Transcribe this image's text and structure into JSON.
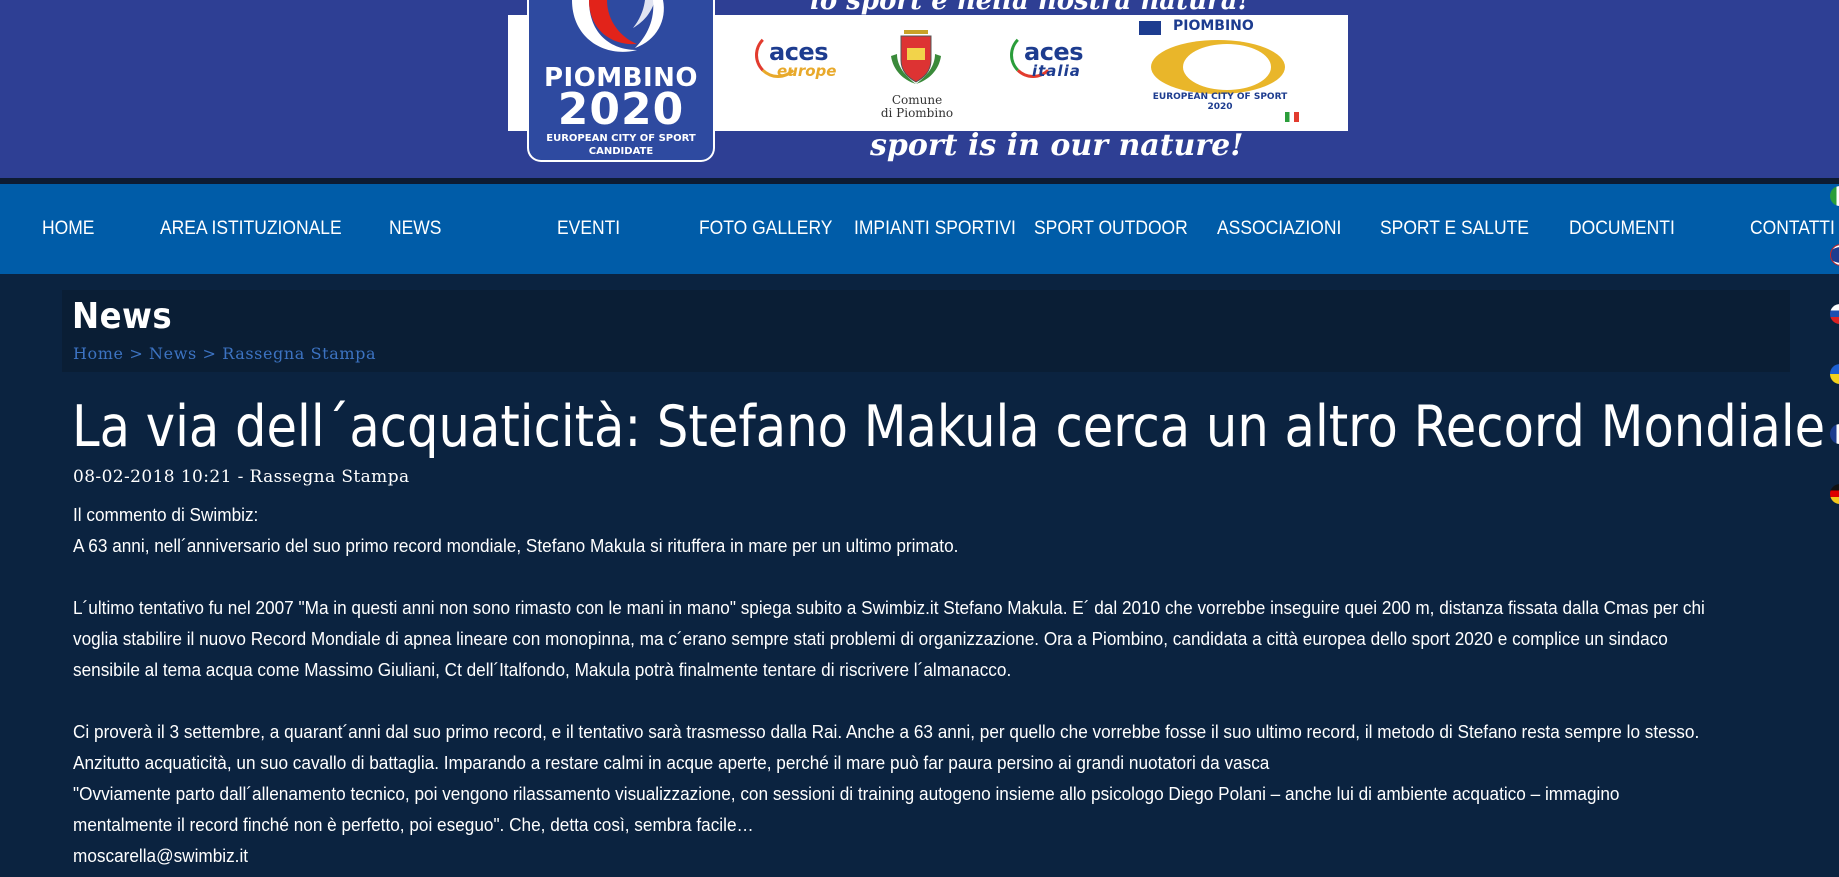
{
  "banner": {
    "top_text": "lo sport è nella nostra natura!",
    "logo_city": "PIOMBINO",
    "logo_year": "2020",
    "logo_sub_line1": "EUROPEAN CITY OF SPORT",
    "logo_sub_line2": "CANDIDATE",
    "aces_europe_word": "aces",
    "aces_europe_sub": "europe",
    "comune_line1": "Comune",
    "comune_line2": "di Piombino",
    "aces_italia_word": "aces",
    "aces_italia_sub": "italia",
    "ecs_title": "PIOMBINO",
    "ecs_sub_line1": "EUROPEAN CITY OF SPORT",
    "ecs_sub_line2": "2020",
    "slogan": "sport is in our nature!",
    "colors": {
      "banner_bg": "#2e3f94",
      "nav_bg": "#005ca8",
      "page_bg": "#0b2340",
      "breadcrumb": "#3c73c2"
    }
  },
  "nav": {
    "items": [
      {
        "label": "HOME"
      },
      {
        "label": "AREA ISTITUZIONALE"
      },
      {
        "label": "NEWS"
      },
      {
        "label": "EVENTI"
      },
      {
        "label": "FOTO GALLERY"
      },
      {
        "label": "IMPIANTI SPORTIVI"
      },
      {
        "label": "SPORT OUTDOOR"
      },
      {
        "label": "ASSOCIAZIONI"
      },
      {
        "label": "SPORT E SALUTE"
      },
      {
        "label": "DOCUMENTI"
      },
      {
        "label": "CONTATTI"
      }
    ]
  },
  "flags": [
    "italy-flag-icon",
    "uk-flag-icon",
    "russia-flag-icon",
    "ukraine-flag-icon",
    "france-flag-icon",
    "germany-flag-icon"
  ],
  "page": {
    "heading": "News",
    "breadcrumb": {
      "home": "Home",
      "news": "News",
      "section": "Rassegna Stampa",
      "separator": ">"
    }
  },
  "article": {
    "title": "La via dell´acquaticità: Stefano Makula cerca un altro Record Mondiale",
    "meta": "08-02-2018 10:21 - Rassegna Stampa",
    "paragraphs": {
      "p1": "Il commento di Swimbiz:",
      "p2": "A 63 anni, nell´anniversario del suo primo record mondiale, Stefano Makula si rituffera in mare per un ultimo primato.",
      "p3": "L´ultimo tentativo fu nel 2007 \"Ma in questi anni non sono rimasto con le mani in mano\" spiega subito a Swimbiz.it Stefano Makula. E´ dal 2010 che vorrebbe inseguire quei 200 m, distanza fissata dalla Cmas per chi voglia stabilire il nuovo Record Mondiale di apnea lineare con monopinna, ma c´erano sempre stati problemi di organizzazione. Ora a Piombino, candidata a città europea dello sport 2020 e complice un sindaco sensibile al tema acqua come Massimo Giuliani, Ct dell´Italfondo, Makula potrà finalmente tentare di riscrivere l´almanacco.",
      "p4": "Ci proverà il 3 settembre, a quarant´anni dal suo primo record, e il tentativo sarà trasmesso dalla Rai. Anche a 63 anni, per quello che vorrebbe fosse il suo ultimo record, il metodo di Stefano resta sempre lo stesso. Anzitutto acquaticità, un suo cavallo di battaglia. Imparando a restare calmi in acque aperte, perché il mare può far paura persino ai grandi nuotatori da vasca",
      "p5": "\"Ovviamente parto dall´allenamento tecnico, poi vengono rilassamento visualizzazione, con sessioni di training autogeno insieme allo psicologo Diego Polani – anche lui di ambiente acquatico – immagino mentalmente il record finché non è perfetto, poi eseguo\". Che, detta così, sembra facile…",
      "p6": "moscarella@swimbiz.it"
    }
  }
}
